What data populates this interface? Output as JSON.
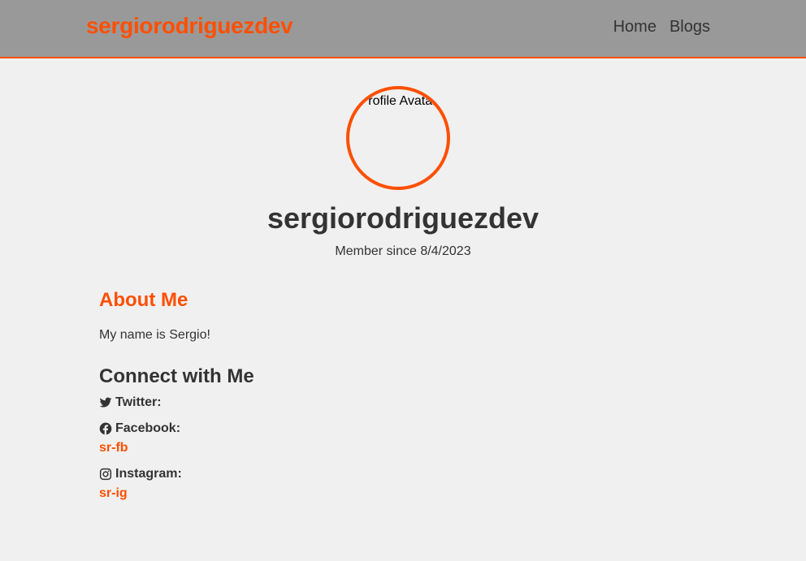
{
  "navbar": {
    "brand": "sergiorodriguezdev",
    "links": [
      "Home",
      "Blogs"
    ]
  },
  "profile": {
    "avatar_alt": "Profile Avatar",
    "username": "sergiorodriguezdev",
    "member_since": "Member since 8/4/2023"
  },
  "about": {
    "heading": "About Me",
    "text": "My name is Sergio!"
  },
  "connect": {
    "heading": "Connect with Me",
    "twitter_label": "Twitter:",
    "facebook_label": "Facebook:",
    "facebook_handle": "sr-fb",
    "instagram_label": "Instagram:",
    "instagram_handle": "sr-ig"
  },
  "colors": {
    "accent": "#ff4f00",
    "navbar_bg": "#999999",
    "page_bg": "#f0f0f0",
    "text": "#333333"
  },
  "icons": [
    "twitter-icon",
    "facebook-icon",
    "instagram-icon"
  ]
}
